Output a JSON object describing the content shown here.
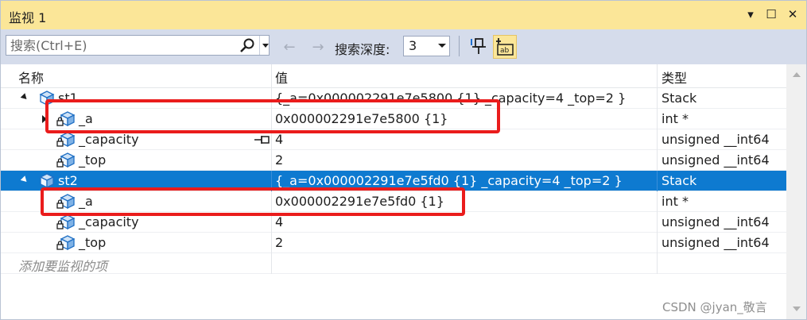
{
  "window": {
    "title": "监视 1",
    "buttons": {
      "dropdown": "▾",
      "maximize": "☐",
      "close": "✕"
    }
  },
  "toolbar": {
    "search_placeholder": "搜索(Ctrl+E)",
    "search_value": "",
    "back_label": "←",
    "forward_label": "→",
    "depth_label": "搜索深度:",
    "depth_value": "3",
    "icons": [
      "search-icon",
      "back-arrow-icon",
      "forward-arrow-icon",
      "pin-icon",
      "hex-display-icon"
    ]
  },
  "columns": {
    "name": "名称",
    "value": "值",
    "type": "类型"
  },
  "rows": [
    {
      "name": "st1",
      "value": "{_a=0x000002291e7e5800 {1} _capacity=4 _top=2 }",
      "type": "Stack",
      "expanded": true,
      "indent": 0,
      "icon": "object-icon"
    },
    {
      "name": "_a",
      "value": "0x000002291e7e5800 {1}",
      "type": "int *",
      "expanded": false,
      "indent": 1,
      "icon": "private-field-icon"
    },
    {
      "name": "_capacity",
      "value": "4",
      "type": "unsigned __int64",
      "indent": 1,
      "icon": "private-field-icon"
    },
    {
      "name": "_top",
      "value": "2",
      "type": "unsigned __int64",
      "indent": 1,
      "icon": "private-field-icon"
    },
    {
      "name": "st2",
      "value": "{_a=0x000002291e7e5fd0 {1} _capacity=4 _top=2 }",
      "type": "Stack",
      "expanded": true,
      "indent": 0,
      "icon": "object-icon",
      "selected": true
    },
    {
      "name": "_a",
      "value": "0x000002291e7e5fd0 {1}",
      "type": "int *",
      "indent": 1,
      "icon": "private-field-icon"
    },
    {
      "name": "_capacity",
      "value": "4",
      "type": "unsigned __int64",
      "indent": 1,
      "icon": "private-field-icon"
    },
    {
      "name": "_top",
      "value": "2",
      "type": "unsigned __int64",
      "indent": 1,
      "icon": "private-field-icon"
    }
  ],
  "add_watch_placeholder": "添加要监视的项",
  "watermark": "CSDN @jyan_敬言",
  "colors": {
    "titlebar": "#fbe698",
    "toolbar": "#d5dceb",
    "selection": "#0e7ad0",
    "annotation": "#ea1c1c"
  }
}
